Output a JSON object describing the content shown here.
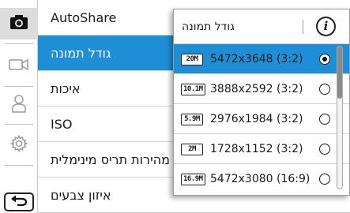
{
  "rail": {
    "items": [
      {
        "icon": "camera-icon",
        "active": true
      },
      {
        "icon": "video-camera-icon",
        "active": false
      },
      {
        "icon": "person-icon",
        "active": false
      },
      {
        "icon": "gear-icon",
        "active": false
      }
    ],
    "back_icon": "back-arrow-icon"
  },
  "menu": {
    "items": [
      {
        "label": "AutoShare"
      },
      {
        "label": "גודל תמונה",
        "selected": true
      },
      {
        "label": "איכות"
      },
      {
        "label": "ISO"
      },
      {
        "label": "מהירות תריס מינימלית"
      },
      {
        "label": "איזון צבעים"
      }
    ]
  },
  "panel": {
    "title": "גודל תמונה",
    "info_icon": "info-icon",
    "info_glyph": "i",
    "options": [
      {
        "badge": "20M",
        "label": "5472x3648 (3:2)",
        "selected": true
      },
      {
        "badge": "10.1M",
        "label": "3888x2592 (3:2)",
        "selected": false
      },
      {
        "badge": "5.9M",
        "label": "2976x1984 (3:2)",
        "selected": false
      },
      {
        "badge": "2M",
        "label": "1728x1152 (3:2)",
        "selected": false
      },
      {
        "badge": "16.9M",
        "label": "5472x3080 (16:9)",
        "selected": false
      }
    ]
  },
  "scrollbar": {
    "position": 0.0
  },
  "colors": {
    "accent": "#1e8ed6",
    "rail_active": "#dcdcdc"
  }
}
